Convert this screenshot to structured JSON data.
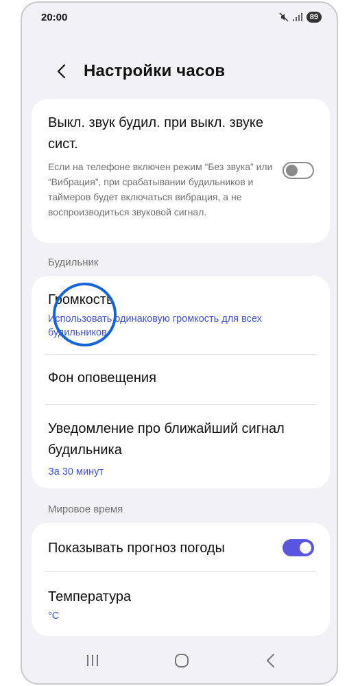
{
  "status_bar": {
    "time": "20:00",
    "icons": [
      "mute-icon",
      "signal-icon"
    ],
    "battery": "89"
  },
  "header": {
    "title": "Настройки часов",
    "back_icon": "chevron-left-icon"
  },
  "mute_setting": {
    "title": "Выкл. звук будил. при выкл. звуке сист.",
    "description": "Если на телефоне включен режим “Без звука” или “Вибрация”, при срабатывании будильников и таймеров будет включаться вибрация, а не воспроизводиться звуковой сигнал.",
    "toggle_state": "off"
  },
  "alarm_section": {
    "label": "Будильник",
    "items": [
      {
        "title": "Громкость",
        "subtitle": "Использовать одинаковую громкость для всех будильников"
      },
      {
        "title": "Фон оповещения",
        "subtitle": ""
      },
      {
        "title": "Уведомление про ближайший сигнал будильника",
        "subtitle": "За 30 минут"
      }
    ]
  },
  "world_clock_section": {
    "label": "Мировое время",
    "items": [
      {
        "title": "Показывать прогноз погоды",
        "toggle_state": "on"
      },
      {
        "title": "Температура",
        "subtitle": "°C"
      }
    ]
  },
  "nav_bar": {
    "buttons": [
      "recent-apps-icon",
      "home-icon",
      "back-icon"
    ]
  },
  "colors": {
    "accent": "#5a55e0",
    "link": "#3f51d6",
    "highlight_circle": "#1565d8",
    "background": "#f2f2f6"
  }
}
